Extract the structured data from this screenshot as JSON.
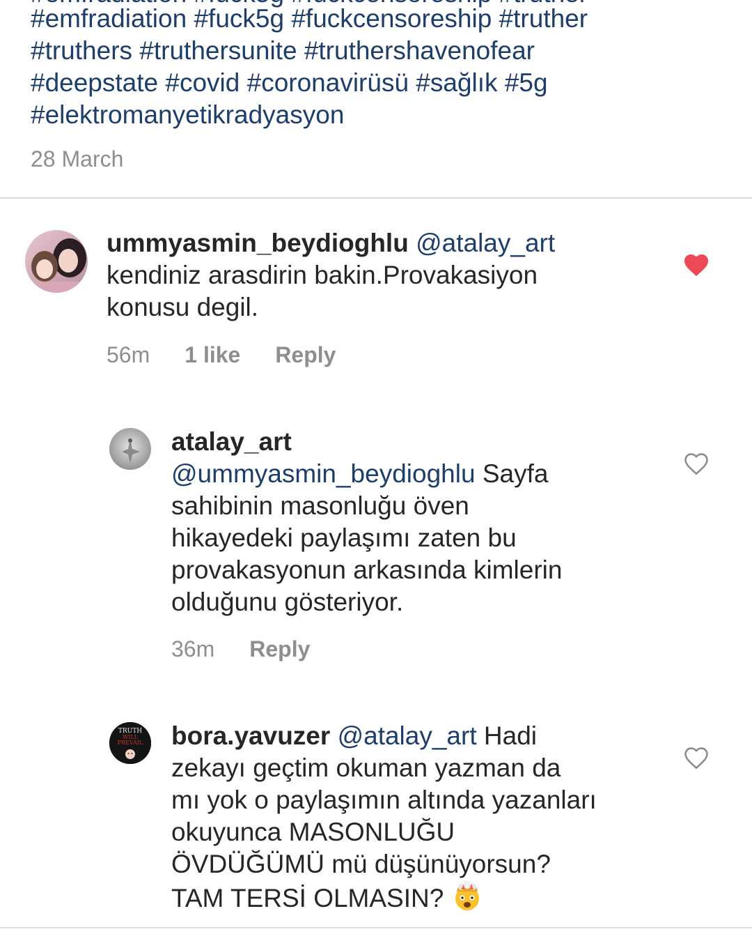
{
  "caption": {
    "partial_line": "#deepstate #covid #coronavirüsü #sağlık #5g",
    "lines": [
      "#emfradiation #fuck5g #fuckcensoreship #truther",
      "#truthers #truthersunite #truthershavenofear",
      "#deepstate #covid #coronavirüsü #sağlık #5g",
      "#elektromanyetikradyasyon"
    ],
    "date": "28 March"
  },
  "comments": [
    {
      "username": "ummyasmin_beydioghlu",
      "mention": "@atalay_art",
      "text_lines": [
        "kendiniz arasdirin bakin.Provakasiyon",
        "konusu degil."
      ],
      "time": "56m",
      "likes": "1 like",
      "reply_label": "Reply",
      "liked": true,
      "like_icon": "heart-filled-icon",
      "like_color": "#ed4956"
    },
    {
      "username": "atalay_art",
      "mention": "@ummyasmin_beydioghlu",
      "text_first": "Sayfa",
      "text_lines": [
        "sahibinin masonluğu öven",
        "hikayedeki paylaşımı zaten bu",
        "provakasyonun arkasında kimlerin",
        "olduğunu gösteriyor."
      ],
      "time": "36m",
      "reply_label": "Reply",
      "liked": false,
      "like_icon": "heart-outline-icon"
    },
    {
      "username": "bora.yavuzer",
      "mention": "@atalay_art",
      "text_first": "Hadi",
      "text_lines": [
        "zekayı geçtim okuman yazman da",
        "mı yok o paylaşımın altında yazanları",
        "okuyunca MASONLUĞU",
        "ÖVDÜĞÜMÜ mü düşünüyorsun?",
        "TAM TERSİ OLMASIN?"
      ],
      "emoji": "exploding-head-emoji",
      "avatar_text": [
        "TRUTH",
        "WILL",
        "PREVAIL"
      ],
      "liked": false,
      "like_icon": "heart-outline-icon"
    }
  ],
  "colors": {
    "link": "#1d3d6b",
    "meta": "#8e8e8e",
    "text": "#262626",
    "divider": "#dbdbdb",
    "liked_heart": "#ed4956"
  }
}
